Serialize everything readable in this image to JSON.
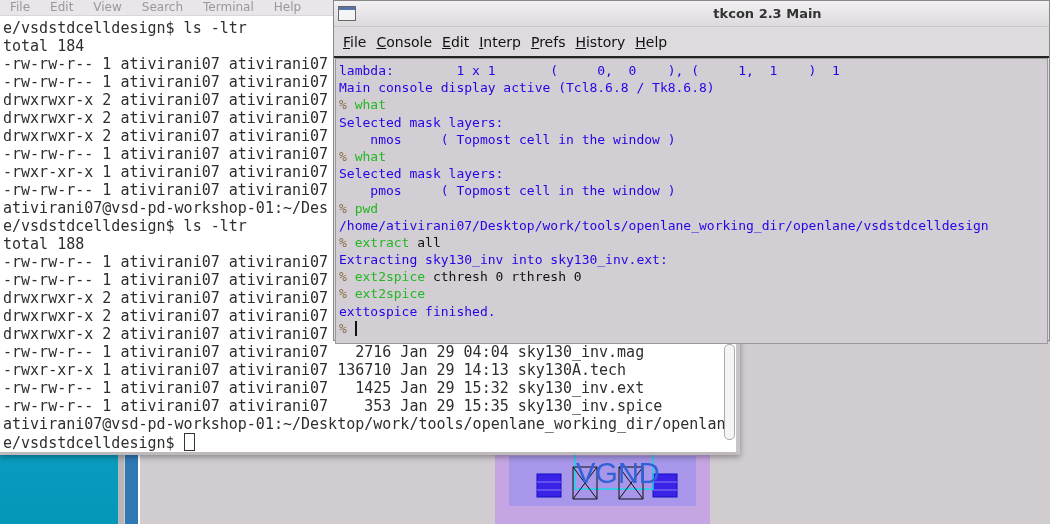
{
  "terminal": {
    "menu": [
      "File",
      "Edit",
      "View",
      "Search",
      "Terminal",
      "Help"
    ],
    "lines": [
      "e/vsdstdcelldesign$ ls -ltr",
      "total 184",
      "-rw-rw-r-- 1 ativirani07 ativirani07",
      "-rw-rw-r-- 1 ativirani07 ativirani07",
      "drwxrwxr-x 2 ativirani07 ativirani07",
      "drwxrwxr-x 2 ativirani07 ativirani07",
      "drwxrwxr-x 2 ativirani07 ativirani07",
      "-rw-rw-r-- 1 ativirani07 ativirani07",
      "-rwxr-xr-x 1 ativirani07 ativirani07",
      "-rw-rw-r-- 1 ativirani07 ativirani07",
      "ativirani07@vsd-pd-workshop-01:~/Des",
      "e/vsdstdcelldesign$ ls -ltr",
      "total 188",
      "-rw-rw-r-- 1 ativirani07 ativirani07",
      "-rw-rw-r-- 1 ativirani07 ativirani07",
      "drwxrwxr-x 2 ativirani07 ativirani07",
      "drwxrwxr-x 2 ativirani07 ativirani07",
      "drwxrwxr-x 2 ativirani07 ativirani07",
      "-rw-rw-r-- 1 ativirani07 ativirani07   2716 Jan 29 04:04 sky130_inv.mag",
      "-rwxr-xr-x 1 ativirani07 ativirani07 136710 Jan 29 14:13 sky130A.tech",
      "-rw-rw-r-- 1 ativirani07 ativirani07   1425 Jan 29 15:32 sky130_inv.ext",
      "-rw-rw-r-- 1 ativirani07 ativirani07    353 Jan 29 15:35 sky130_inv.spice",
      "ativirani07@vsd-pd-workshop-01:~/Desktop/work/tools/openlane_working_dir/openlan"
    ],
    "prompt": "e/vsdstdcelldesign$"
  },
  "tkcon": {
    "title": "tkcon 2.3 Main",
    "menu": [
      "File",
      "Console",
      "Edit",
      "Interp",
      "Prefs",
      "History",
      "Help"
    ],
    "lines": [
      {
        "kind": "output",
        "text": "lambda:        1 x 1       (     0,  0    ), (     1,  1    )  1"
      },
      {
        "kind": "output",
        "text": "Main console display active (Tcl8.6.8 / Tk8.6.8)"
      },
      {
        "kind": "command",
        "prompt": "%",
        "command": "what"
      },
      {
        "kind": "output",
        "text": "Selected mask layers:"
      },
      {
        "kind": "output",
        "text": "    nmos     ( Topmost cell in the window )"
      },
      {
        "kind": "command",
        "prompt": "%",
        "command": "what"
      },
      {
        "kind": "output",
        "text": "Selected mask layers:"
      },
      {
        "kind": "output",
        "text": "    pmos     ( Topmost cell in the window )"
      },
      {
        "kind": "command",
        "prompt": "%",
        "command": "pwd"
      },
      {
        "kind": "output",
        "text": "/home/ativirani07/Desktop/work/tools/openlane_working_dir/openlane/vsdstdcelldesign"
      },
      {
        "kind": "command",
        "prompt": "%",
        "command": "extract",
        "args": "all"
      },
      {
        "kind": "output",
        "text": "Extracting sky130_inv into sky130_inv.ext:"
      },
      {
        "kind": "command",
        "prompt": "%",
        "command": "ext2spice",
        "args": "cthresh 0 rthresh 0"
      },
      {
        "kind": "command",
        "prompt": "%",
        "command": "ext2spice"
      },
      {
        "kind": "output",
        "text": "exttospice finished."
      },
      {
        "kind": "input",
        "prompt": "%"
      }
    ]
  },
  "layout": {
    "label": "VGND"
  }
}
